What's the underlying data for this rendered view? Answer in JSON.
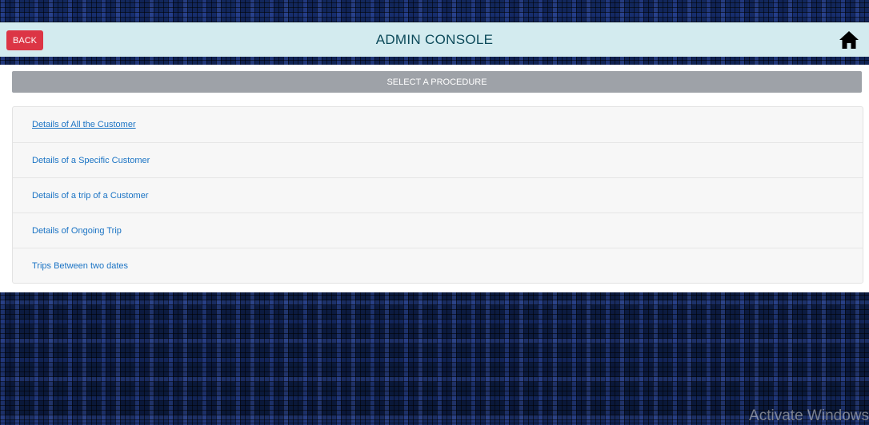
{
  "topbar": {
    "back_label": "BACK",
    "title": "ADMIN CONSOLE",
    "home_icon": "home-icon"
  },
  "panel": {
    "header": "SELECT A PROCEDURE",
    "items": [
      {
        "label": "Details of All the Customer"
      },
      {
        "label": "Details of a Specific Customer"
      },
      {
        "label": "Details of a trip of a Customer"
      },
      {
        "label": "Details of Ongoing Trip"
      },
      {
        "label": "Trips Between two dates"
      }
    ]
  },
  "watermark": "Activate Windows",
  "colors": {
    "topbar_bg": "#d3ebef",
    "back_button": "#dc3545",
    "header_bar": "#9ea2a8",
    "link": "#1a73c4"
  }
}
